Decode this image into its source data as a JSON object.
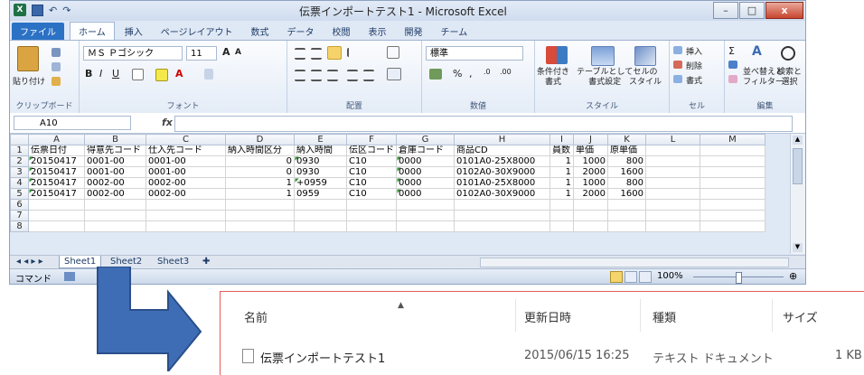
{
  "window": {
    "title": "伝票インポートテスト1 - Microsoft Excel",
    "minimize": "–",
    "maximize": "□",
    "close": "x",
    "qat_undo": "↶",
    "qat_redo": "↷"
  },
  "ribbon_tabs": [
    "ファイル",
    "ホーム",
    "挿入",
    "ページレイアウト",
    "数式",
    "データ",
    "校閲",
    "表示",
    "開発",
    "チーム"
  ],
  "ribbon": {
    "clipboard_group": "クリップボード",
    "paste": "貼り付け",
    "font_group": "フォント",
    "font_name": "ＭＳ Ｐゴシック",
    "font_size": "11",
    "alignment_group": "配置",
    "number_group": "数値",
    "number_format": "標準",
    "styles_group": "スタイル",
    "conditional": "条件付き\n書式",
    "table_format": "テーブルとして\n書式設定",
    "cell_styles": "セルの\nスタイル",
    "cells_group": "セル",
    "insert": "挿入",
    "delete": "削除",
    "format": "書式",
    "editing_group": "編集",
    "sort_filter": "並べ替えと\nフィルター",
    "find_select": "検索と\n選択"
  },
  "formula_bar": {
    "name_box": "A10",
    "fx": "fx",
    "value": ""
  },
  "grid": {
    "columns": [
      "A",
      "B",
      "C",
      "D",
      "E",
      "F",
      "G",
      "H",
      "I",
      "J",
      "K",
      "L",
      "M"
    ],
    "row_numbers": [
      "1",
      "2",
      "3",
      "4",
      "5",
      "6",
      "7",
      "8"
    ],
    "rows": [
      [
        "伝票日付",
        "得意先コード",
        "仕入先コード",
        "納入時間区分",
        "納入時間",
        "伝区コード",
        "倉庫コード",
        "商品CD",
        "員数",
        "単価",
        "原単価",
        "",
        ""
      ],
      [
        "20150417",
        "0001-00",
        "0001-00",
        "0",
        "0930",
        "C10",
        "0000",
        "0101A0-25X8000",
        "1",
        "1000",
        "800",
        "",
        ""
      ],
      [
        "20150417",
        "0001-00",
        "0001-00",
        "0",
        "0930",
        "C10",
        "0000",
        "0102A0-30X9000",
        "1",
        "2000",
        "1600",
        "",
        ""
      ],
      [
        "20150417",
        "0002-00",
        "0002-00",
        "1",
        "+0959",
        "C10",
        "0000",
        "0101A0-25X8000",
        "1",
        "1000",
        "800",
        "",
        ""
      ],
      [
        "20150417",
        "0002-00",
        "0002-00",
        "1",
        "0959",
        "C10",
        "0000",
        "0102A0-30X9000",
        "1",
        "2000",
        "1600",
        "",
        ""
      ],
      [
        "",
        "",
        "",
        "",
        "",
        "",
        "",
        "",
        "",
        "",
        "",
        "",
        ""
      ],
      [
        "",
        "",
        "",
        "",
        "",
        "",
        "",
        "",
        "",
        "",
        "",
        "",
        ""
      ],
      [
        "",
        "",
        "",
        "",
        "",
        "",
        "",
        "",
        "",
        "",
        "",
        "",
        ""
      ]
    ]
  },
  "sheets": [
    "Sheet1",
    "Sheet2",
    "Sheet3"
  ],
  "status": {
    "mode": "コマンド",
    "zoom": "100%"
  },
  "explorer": {
    "headers": {
      "name": "名前",
      "modified": "更新日時",
      "type": "種類",
      "size": "サイズ"
    },
    "file": {
      "name": "伝票インポートテスト1",
      "modified": "2015/06/15 16:25",
      "type": "テキスト ドキュメント",
      "size": "1 KB"
    }
  },
  "colors": {
    "arrow": "#3f6db5",
    "arrow_stroke": "#2a4f8a",
    "file_tab": "#2b72c5",
    "explorer_border": "#e45a5a"
  }
}
